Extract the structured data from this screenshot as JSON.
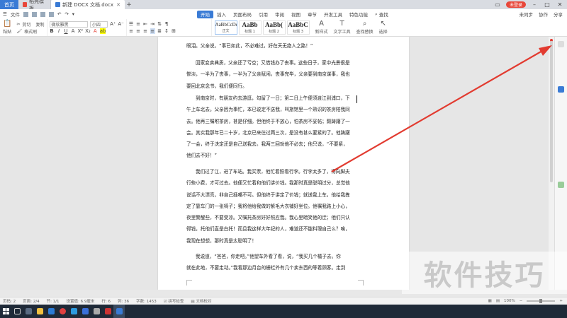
{
  "titlebar": {
    "tabs": [
      {
        "label": "首页"
      },
      {
        "label": "稻壳模板"
      },
      {
        "label": "新建 DOCX 文档.docx"
      }
    ],
    "login": "未登录"
  },
  "menubar": {
    "file": "文件",
    "tabs": [
      "开始",
      "插入",
      "页面布局",
      "引用",
      "审阅",
      "视图",
      "章节",
      "开发工具",
      "特色功能",
      "查找"
    ],
    "active_tab": "开始",
    "right": [
      "未同步",
      "协作",
      "分享"
    ]
  },
  "ribbon": {
    "paste": "粘贴",
    "cut": "剪切",
    "copy": "复制",
    "format_painter": "格式刷",
    "font_name": "微软雅黑",
    "font_size": "小四",
    "styles": [
      {
        "sample": "AaBbCcDd",
        "name": "正文"
      },
      {
        "sample": "AaBb",
        "name": "标题 1"
      },
      {
        "sample": "AaBb(",
        "name": "标题 2"
      },
      {
        "sample": "AaBbC",
        "name": "标题 3"
      }
    ],
    "new_style": "新样式",
    "text_tools": "文字工具",
    "find_replace": "查找替换",
    "select": "选择"
  },
  "document": {
    "paragraphs": [
      {
        "lines": [
          "眼泪。父亲说，“事已如此，不必难过，好在天无绝人之路！”"
        ]
      },
      {
        "lines": [
          "回家变卖典质，父亲还了亏空；又借钱办了丧事。这些日子，家中光景很是",
          "惨淡，一半为了丧事，一半为了父亲赋闲。丧事完毕，父亲要到南京谋事，我也",
          "要回北京念书，我们便同行。"
        ]
      },
      {
        "lines": [
          "到南京时，有朋友约去游逛，勾留了一日；第二日上午便须渡江到浦口，下",
          "午上车北去。父亲因为事忙，本已说定不送我，叫旅馆里一个熟识的茶房陪我同",
          "去。他再三嘱咐茶房，甚是仔细。但他终于不放心，怕茶房不妥帖；颇踌躇了一",
          "会。其实我那年已二十岁，北京已来往过两三次，是没有甚么要紧的了。他踌躇",
          "了一会，终于决定还是自己送我去。我两三回劝他不必去；他只说，“不要紧，",
          "他们去不好！”"
        ]
      },
      {
        "lines": [
          "我们过了江，进了车站。我买票，他忙着照看行李。行李太多了，得向脚夫",
          "行些小费，才可过去。他便又忙着和他们讲价钱。我那时真是聪明过分，总觉他",
          "说话不大漂亮，非自己插嘴不可。但他终于讲定了价钱；就送我上车。他给我拣",
          "定了靠车门的一张椅子；我将他给我做的紫毛大衣铺好坐位。他嘱我路上小心，",
          "夜里警醒些，不要受凉。又嘱托茶房好好照应我。我心里暗笑他的迂；他们只认",
          "得钱，托他们直是白托！而且我这样大年纪的人，难道还不能料理自己么？唉，",
          "我现在想想，那时真是太聪明了！"
        ]
      },
      {
        "lines": [
          "我说道，“爸爸，你走吧。”他望车外看了看，说，“我买几个橘子去。你",
          "就在此地，不要走动。”我看那边月台的栅栏外有几个卖东西的等着顾客。走到"
        ]
      }
    ]
  },
  "watermark": "软件技巧",
  "statusbar": {
    "page": "页码: 2",
    "pages": "页面: 2/4",
    "section": "节: 1/1",
    "setting": "设置值: 6.9厘米",
    "row": "行: 6",
    "col": "列: 36",
    "words": "字数: 1453",
    "spell": "拼写检查",
    "doc_check": "文档校对",
    "zoom": "100%"
  },
  "colors": {
    "accent": "#3a7bd5",
    "arrow": "#e23b30",
    "login": "#e8473a"
  },
  "icons": {
    "arrow": "red-annotation-arrow"
  }
}
